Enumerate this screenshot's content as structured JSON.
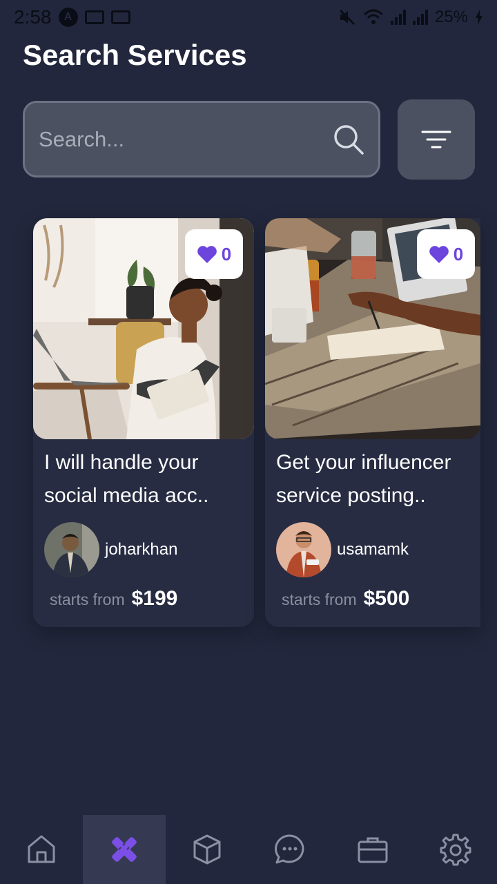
{
  "status_bar": {
    "time": "2:58",
    "badge": "A",
    "battery": "25%"
  },
  "header": {
    "title": "Search Services"
  },
  "search": {
    "placeholder": "Search...",
    "value": ""
  },
  "services": [
    {
      "title_line1": "I will handle your",
      "title_line2": "social media acc..",
      "likes": "0",
      "seller": "joharkhan",
      "price_label": "starts from",
      "price": "$199"
    },
    {
      "title_line1": "Get your influencer",
      "title_line2": "service posting..",
      "likes": "0",
      "seller": "usamamk",
      "price_label": "starts from",
      "price": "$500"
    }
  ],
  "bottom_nav": {
    "items": [
      {
        "icon": "home-icon",
        "active": false
      },
      {
        "icon": "services-tools-icon",
        "active": true
      },
      {
        "icon": "box-icon",
        "active": false
      },
      {
        "icon": "chat-icon",
        "active": false
      },
      {
        "icon": "briefcase-icon",
        "active": false
      },
      {
        "icon": "settings-gear-icon",
        "active": false
      }
    ]
  },
  "colors": {
    "background": "#22273d",
    "card": "#272c42",
    "accent": "#6c45dc",
    "input": "#4c5161",
    "muted_text": "#8a8fa0"
  }
}
